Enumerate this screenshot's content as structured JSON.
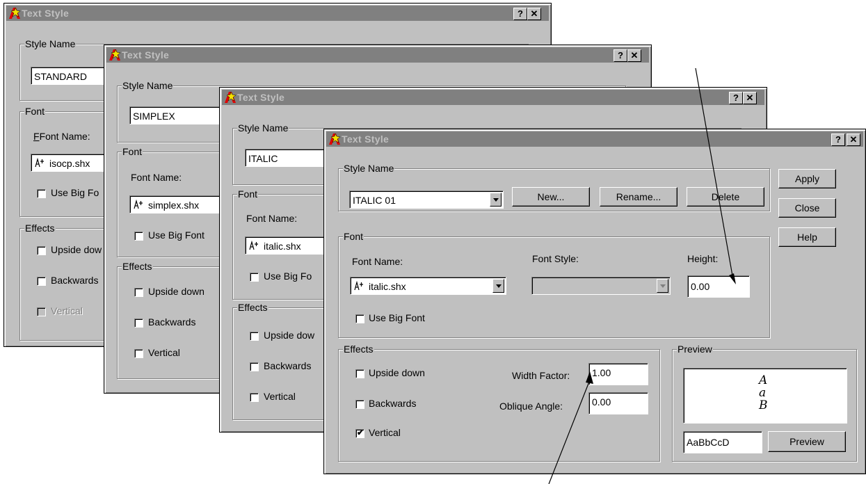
{
  "common": {
    "help_btn": "?",
    "close_btn": "✕",
    "style_name_group": "Style Name",
    "font_group": "Font",
    "effects_group": "Effects",
    "font_name_label": "Font Name:",
    "use_big_font": "Use Big Font",
    "use_big_font_trunc": "Use Big Fo",
    "upside_down": "Upside down",
    "upside_down_trunc": "Upside dow",
    "backwards": "Backwards",
    "backwards_trunc": "Backwards",
    "backwards_trunc2": "Backwards",
    "vertical": "Vertical"
  },
  "dialogs": [
    {
      "title": "Text Style",
      "style_name": "STANDARD",
      "font_name": "isocp.shx"
    },
    {
      "title": "Text Style",
      "style_name": "SIMPLEX",
      "font_name": "simplex.shx"
    },
    {
      "title": "Text Style",
      "style_name": "ITALIC",
      "font_name": "italic.shx"
    },
    {
      "title": "Text Style",
      "style_name": "ITALIC 01",
      "buttons": {
        "new": "New...",
        "rename": "Rename...",
        "delete": "Delete",
        "apply": "Apply",
        "close": "Close",
        "help": "Help"
      },
      "font_name": "italic.shx",
      "font_style_label": "Font Style:",
      "font_style_value": "",
      "height_label": "Height:",
      "height_value": "0.00",
      "width_factor_label": "Width Factor:",
      "width_factor_value": "1.00",
      "oblique_angle_label": "Oblique Angle:",
      "oblique_angle_value": "0.00",
      "effects": {
        "upside_down": false,
        "backwards": false,
        "vertical": true
      },
      "preview_group": "Preview",
      "preview_chars": [
        "A",
        "a",
        "B"
      ],
      "preview_text": "AaBbCcD",
      "preview_button": "Preview"
    }
  ],
  "colors": {
    "face": "#c0c0c0",
    "title_inactive": "#808080",
    "title_text": "#c0c0c0"
  }
}
